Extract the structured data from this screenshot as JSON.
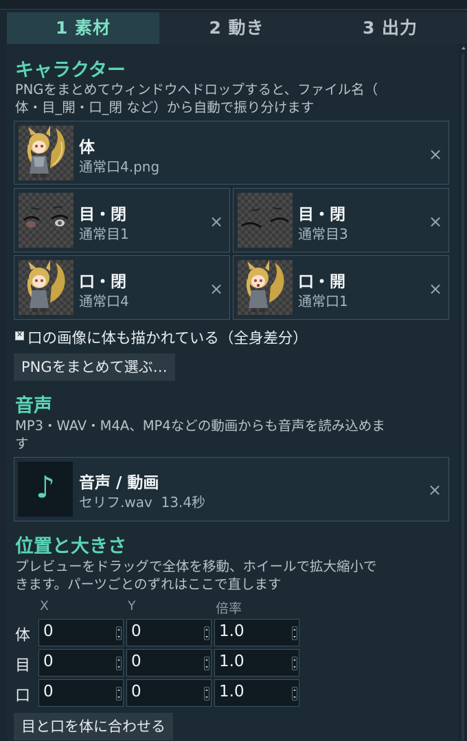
{
  "tabs": [
    {
      "label": "1  素材",
      "active": true
    },
    {
      "label": "2  動き",
      "active": false
    },
    {
      "label": "3  出力",
      "active": false
    }
  ],
  "character": {
    "heading": "キャラクター",
    "desc_line1": "PNGをまとめてウィンドウへドロップすると、ファイル名（",
    "desc_line2": "体・目_開・口_閉 など）から自動で振り分けます",
    "body": {
      "title": "体",
      "file": "通常口4.png"
    },
    "eye_closed": {
      "title": "目・閉",
      "file": "通常目1"
    },
    "eye_open": {
      "title": "目・閉",
      "file": "通常目3"
    },
    "mouth_closed": {
      "title": "口・閉",
      "file": "通常口4"
    },
    "mouth_open": {
      "title": "口・開",
      "file": "通常口1"
    },
    "remove_icon": "×",
    "fullbody_checkbox": {
      "label": "口の画像に体も描かれている（全身差分）",
      "checked": true
    },
    "choose_button": "PNGをまとめて選ぶ…"
  },
  "audio": {
    "heading": "音声",
    "desc_line1": "MP3・WAV・M4A、MP4などの動画からも音声を読み込めま",
    "desc_line2": "す",
    "card_title": "音声 / 動画",
    "card_sub": "セリフ.wav  13.4秒",
    "note_glyph": "♪"
  },
  "position": {
    "heading": "位置と大きさ",
    "desc_line1": "プレビューをドラッグで全体を移動、ホイールで拡大縮小で",
    "desc_line2": "きます。パーツごとのずれはここで直します",
    "col_x": "X",
    "col_y": "Y",
    "col_scale": "倍率",
    "rows": [
      {
        "label": "体",
        "x": "0",
        "y": "0",
        "scale": "1.0"
      },
      {
        "label": "目",
        "x": "0",
        "y": "0",
        "scale": "1.0"
      },
      {
        "label": "口",
        "x": "0",
        "y": "0",
        "scale": "1.0"
      }
    ],
    "fit_button": "目と口を体に合わせる"
  },
  "colors": {
    "accent": "#5cd4b6",
    "background": "#1b2a33",
    "card_border": "#3d5764"
  }
}
